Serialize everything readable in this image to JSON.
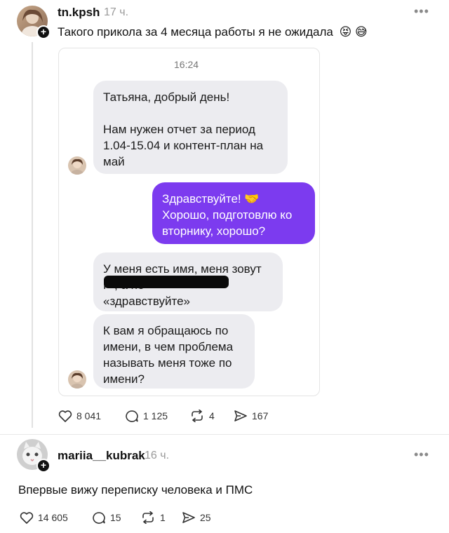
{
  "post": {
    "username": "tn.kpsh",
    "time": "17 ч.",
    "text": "Такого прикола за 4 месяца работы я не ожидала",
    "emoji": "😝 😅",
    "more": "•••",
    "actions": {
      "likes": "8 041",
      "comments": "1 125",
      "reposts": "4",
      "shares": "167"
    }
  },
  "chat": {
    "time": "16:24",
    "messages": [
      {
        "text": "Татьяна, добрый день!\n\nНам нужен отчет за период\n1.04-15.04 и контент-план на\nмай",
        "direction": "in"
      },
      {
        "text": "Здравствуйте! 🤝\nХорошо, подготовлю ко\nвторнику, хорошо?",
        "direction": "out"
      },
      {
        "text": "У меня есть имя, меня зовут\nР                                , а не\n«здравствуйте»",
        "direction": "in"
      },
      {
        "text": "К вам я обращаюсь по\nимени, в чем проблема\nназывать меня тоже по\nимени?",
        "direction": "in"
      }
    ]
  },
  "reply": {
    "username": "mariia__kubrak",
    "time": "16 ч.",
    "more": "•••",
    "text": "Впервые вижу переписку человека и ПМС",
    "actions": {
      "likes": "14 605",
      "comments": "15",
      "reposts": "1",
      "shares": "25"
    }
  },
  "colors": {
    "accent_purple": "#7c3bef",
    "incoming_bubble": "#ececf0"
  }
}
